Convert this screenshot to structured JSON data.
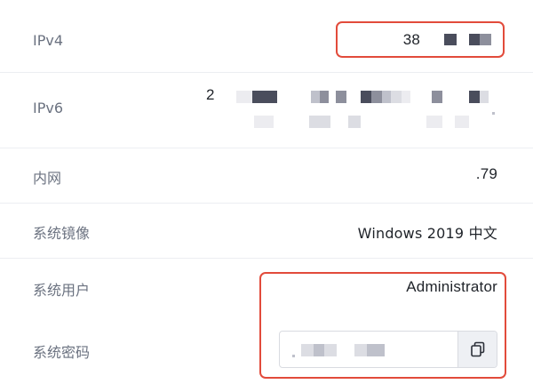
{
  "rows": {
    "ipv4": {
      "label": "IPv4",
      "value": "38"
    },
    "ipv6": {
      "label": "IPv6",
      "value": "2"
    },
    "intranet": {
      "label": "内网",
      "value": ".79"
    },
    "image": {
      "label": "系统镜像",
      "value": "Windows 2019 中文"
    },
    "user": {
      "label": "系统用户",
      "value": "Administrator"
    },
    "password": {
      "label": "系统密码",
      "value": ""
    }
  },
  "icons": {
    "copy": "copy-icon"
  },
  "colors": {
    "highlight": "#e24b3b",
    "label_text": "#6b7280",
    "value_text": "#1f2329",
    "divider": "#eceef2"
  }
}
